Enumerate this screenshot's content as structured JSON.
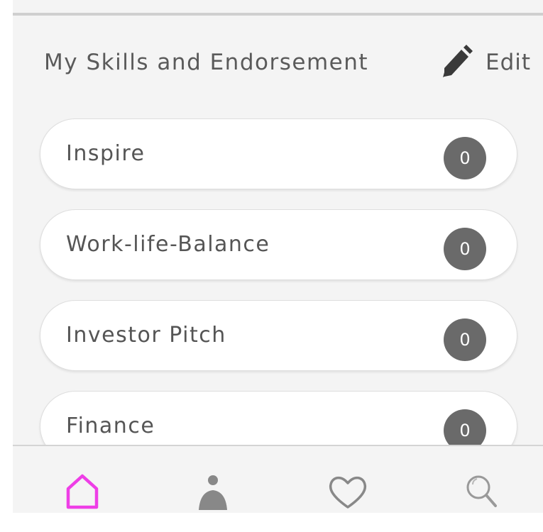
{
  "header": {
    "title": "My Skills and Endorsement",
    "edit_label": "Edit",
    "edit_icon": "pencil-icon"
  },
  "skills": [
    {
      "label": "Inspire",
      "count": "0"
    },
    {
      "label": "Work-life-Balance",
      "count": "0"
    },
    {
      "label": "Investor Pitch",
      "count": "0"
    },
    {
      "label": "Finance",
      "count": "0"
    }
  ],
  "bottom_nav": {
    "items": [
      {
        "icon": "home-icon",
        "active": true
      },
      {
        "icon": "profile-icon",
        "active": false
      },
      {
        "icon": "heart-icon",
        "active": false
      },
      {
        "icon": "search-icon",
        "active": false
      }
    ]
  },
  "colors": {
    "accent": "#ee3ee6",
    "badge": "#6a6a6a",
    "text": "#555555",
    "background": "#f4f4f4"
  }
}
